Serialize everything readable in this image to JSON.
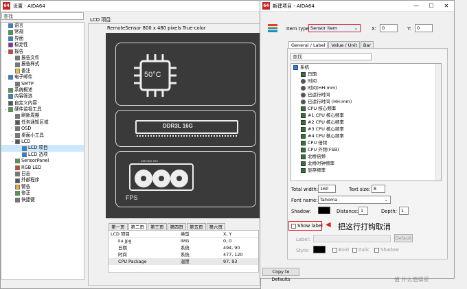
{
  "main_window": {
    "title": "设置 - AIDA64",
    "search_placeholder": "查找",
    "tree": [
      {
        "label": "语言",
        "depth": 0
      },
      {
        "label": "常规",
        "depth": 0
      },
      {
        "label": "界面",
        "depth": 0
      },
      {
        "label": "稳定性",
        "depth": 0
      },
      {
        "label": "报告",
        "depth": 0,
        "expand": "⌄"
      },
      {
        "label": "报告文件",
        "depth": 1
      },
      {
        "label": "报告样式",
        "depth": 1
      },
      {
        "label": "备注",
        "depth": 1
      },
      {
        "label": "电子邮件",
        "depth": 0,
        "expand": "⌄"
      },
      {
        "label": "SMTP",
        "depth": 1
      },
      {
        "label": "系统概述",
        "depth": 0
      },
      {
        "label": "内容筛选",
        "depth": 0
      },
      {
        "label": "自定义内容",
        "depth": 0
      },
      {
        "label": "硬件监视工具",
        "depth": 0,
        "expand": "⌄"
      },
      {
        "label": "刷新周期",
        "depth": 1
      },
      {
        "label": "任务通知区域",
        "depth": 1
      },
      {
        "label": "OSD",
        "depth": 1,
        "expand": "›"
      },
      {
        "label": "桌面小工具",
        "depth": 1,
        "expand": "›"
      },
      {
        "label": "LCD",
        "depth": 1,
        "expand": "⌄"
      },
      {
        "label": "LCD 项目",
        "depth": 2,
        "selected": true
      },
      {
        "label": "LCD 选项",
        "depth": 2
      },
      {
        "label": "SensorPanel",
        "depth": 1
      },
      {
        "label": "RGB LED",
        "depth": 1
      },
      {
        "label": "日志",
        "depth": 1
      },
      {
        "label": "外部程序",
        "depth": 1
      },
      {
        "label": "警告",
        "depth": 1
      },
      {
        "label": "修正",
        "depth": 1
      },
      {
        "label": "快捷键",
        "depth": 1
      }
    ],
    "panel_title": "LCD 项目",
    "device_info": "RemoteSensor 800 x 480 pixels True-color",
    "preview": {
      "temp": "50°C",
      "ram": "DDR3L 16G",
      "gpu_label": "GEFORCE GTX",
      "fps": "FPS"
    },
    "page_tabs": [
      "第一页",
      "第二页",
      "第三页",
      "第四页",
      "第五页",
      "第六页"
    ],
    "active_page_tab": 1,
    "table": {
      "headers": [
        "LCD 项目",
        "类型",
        "X, Y"
      ],
      "rows": [
        [
          "iiu.jpg",
          "IMG",
          "0, 0"
        ],
        [
          "日期",
          "系统",
          "494, 90"
        ],
        [
          "时间",
          "系统",
          "477, 120"
        ],
        [
          "CPU Package",
          "温度",
          "97, 93"
        ]
      ]
    }
  },
  "dialog": {
    "title": "新建项目 - AIDA64",
    "item_type_label": "Item type:",
    "item_type_value": "Sensor item",
    "x_label": "X:",
    "x_value": "0",
    "y_label": "Y:",
    "y_value": "0",
    "tabs": [
      "General / Label",
      "Value / Unit",
      "Bar"
    ],
    "search_placeholder": "查找",
    "list": [
      {
        "label": "系统",
        "kind": "monitor"
      },
      {
        "label": "日期",
        "kind": "grid"
      },
      {
        "label": "时间",
        "kind": "clock"
      },
      {
        "label": "时间(HH:mm)",
        "kind": "clock"
      },
      {
        "label": "已运行时间",
        "kind": "clock"
      },
      {
        "label": "已运行时间 (HH:mm)",
        "kind": "clock"
      },
      {
        "label": "CPU 核心频率",
        "kind": "grid"
      },
      {
        "label": "#1 CPU 核心频率",
        "kind": "grid"
      },
      {
        "label": "#2 CPU 核心频率",
        "kind": "grid"
      },
      {
        "label": "#3 CPU 核心频率",
        "kind": "grid"
      },
      {
        "label": "#4 CPU 核心频率",
        "kind": "grid"
      },
      {
        "label": "CPU 倍频",
        "kind": "grid"
      },
      {
        "label": "CPU 外频(FSB)",
        "kind": "grid"
      },
      {
        "label": "北桥倍频",
        "kind": "grid"
      },
      {
        "label": "北桥时钟频率",
        "kind": "grid"
      },
      {
        "label": "显存频率",
        "kind": "grid"
      }
    ],
    "total_width_label": "Total width:",
    "total_width": "160",
    "text_size_label": "Text size:",
    "text_size": "8",
    "font_name_label": "Font name:",
    "font_name": "Tahoma",
    "shadow_label": "Shadow:",
    "distance_label": "Distance:",
    "distance": "1",
    "depth_label": "Depth:",
    "depth": "1",
    "show_label": "Show label",
    "label_label": "Label:",
    "default_btn": "Default",
    "style_label": "Style:",
    "bold": "Bold",
    "italic": "Italic",
    "shadow_cb": "Shadow",
    "copy_defaults": "Copy to Defaults"
  },
  "annotation": "把这行打钩取消",
  "watermark": "值 什么值得买",
  "colors": {
    "accent_red": "#e02020",
    "selection": "#cce8ff",
    "panel_dark": "#3a3a3a"
  }
}
